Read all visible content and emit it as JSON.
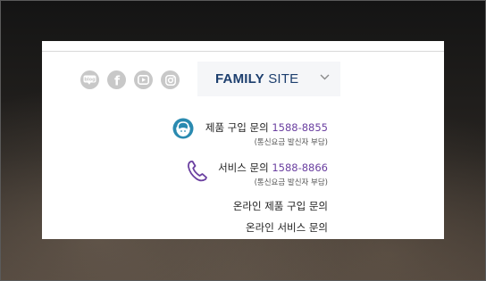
{
  "social": [
    {
      "icon": "blog-icon",
      "label": "blog"
    },
    {
      "icon": "facebook-icon",
      "label": "f"
    },
    {
      "icon": "youtube-icon",
      "label": ""
    },
    {
      "icon": "instagram-icon",
      "label": ""
    }
  ],
  "family_site": {
    "bold": "FAMILY",
    "light": "SITE"
  },
  "contacts": [
    {
      "icon": "headset-agent-icon",
      "label": "제품 구입 문의",
      "number": "1588-8855",
      "note": "(통신요금 발신자 부담)"
    },
    {
      "icon": "phone-icon",
      "label": "서비스 문의",
      "number": "1588-8866",
      "note": "(통신요금 발신자 부담)"
    }
  ],
  "links": [
    {
      "label": "온라인 제품 구입 문의"
    },
    {
      "label": "온라인 서비스 문의"
    }
  ],
  "colors": {
    "brand_navy": "#1d3f6e",
    "accent_purple": "#6a3fa0",
    "agent_teal": "#2a8ab0",
    "social_gray": "#c8c8c8"
  }
}
